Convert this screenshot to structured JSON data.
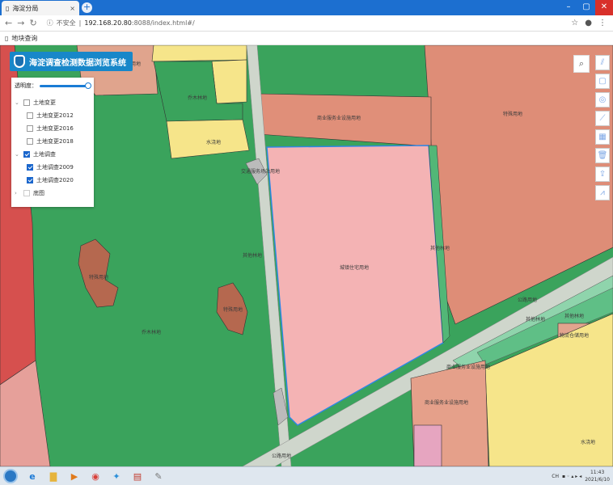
{
  "browser": {
    "tab_title": "海淀分局",
    "tab_close": "×",
    "new_tab": "+",
    "security_label": "不安全",
    "url_host": "192.168.20.80",
    "url_rest": ":8088/index.html#/",
    "bookmark": "地块查询"
  },
  "app": {
    "title": "海淀调查检测数据浏览系统"
  },
  "panel": {
    "opacity_label": "透明度：",
    "opacity_value": 0.9,
    "items": [
      {
        "label": "土地变更",
        "checked": false,
        "level": 0,
        "expanded": true
      },
      {
        "label": "土地变更2012",
        "checked": false,
        "level": 1
      },
      {
        "label": "土地变更2016",
        "checked": false,
        "level": 1
      },
      {
        "label": "土地变更2018",
        "checked": false,
        "level": 1
      },
      {
        "label": "土地调查",
        "checked": true,
        "level": 0,
        "expanded": true
      },
      {
        "label": "土地调查2009",
        "checked": true,
        "level": 1
      },
      {
        "label": "土地调查2020",
        "checked": true,
        "level": 1
      },
      {
        "label": "底图",
        "checked": false,
        "level": 0,
        "expanded": false
      }
    ]
  },
  "map_labels": {
    "l1": "商业服务业设施用地",
    "l2": "乔木林地",
    "l3": "水浇地",
    "l4": "商业服务业设施用地",
    "l5": "特殊用地",
    "l6": "城镇住宅用地",
    "l7": "特殊用地",
    "l8": "特殊用地",
    "l9": "乔木林地",
    "l10": "公路用地",
    "l11": "其他林地",
    "l12": "其他林地",
    "l13": "物流仓储用地",
    "l14": "商业服务业设施用地",
    "l15": "商业服务业设施用地",
    "l16": "公路用地",
    "l17": "水浇地",
    "l18": "交通服务场站用地",
    "l19": "其他林地",
    "l20": "其他林地"
  },
  "colors": {
    "green": "#3aa35c",
    "pink": "#f4b3b4",
    "salmon": "#e0a48d",
    "red": "#d6504e",
    "yellow": "#f6e58a",
    "road": "#cfd6cc",
    "selection": "#2d86e6"
  },
  "taskbar": {
    "time": "11:43",
    "date": "2021/6/10",
    "input": "CH"
  }
}
